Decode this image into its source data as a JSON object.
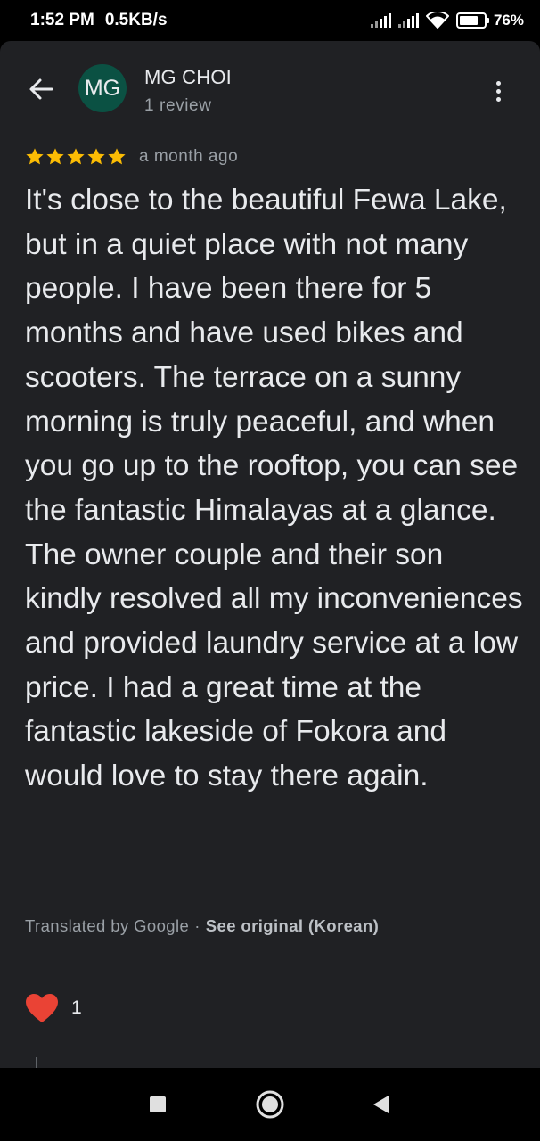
{
  "status_bar": {
    "time": "1:52 PM",
    "speed": "0.5KB/s",
    "battery_percent": "76",
    "battery_level": 0.76
  },
  "header": {
    "back_icon": "arrow-back-icon",
    "avatar_initials": "MG",
    "avatar_color": "#0b5143",
    "author_name": "MG CHOI",
    "author_meta": "1 review",
    "menu_icon": "more-vert-icon"
  },
  "review": {
    "rating": 5,
    "star_color": "#fbbc04",
    "date": "a month ago",
    "text": "It's close to the beautiful Fewa Lake, but in a quiet place with not many people. I have been there for 5 months and have used bikes and scooters. The terrace on a sunny morning is truly peaceful, and when you go up to the rooftop, you can see the fantastic Himalayas at a glance. The owner couple and their son kindly resolved all my inconveniences and provided laundry service at a low price. I had a great time at the fantastic lakeside of Fokora and would love to stay there again.",
    "translated_by": "Translated by Google",
    "separator": "·",
    "see_original": "See original (Korean)"
  },
  "reactions": {
    "icon": "heart-icon",
    "color": "#ea4335",
    "count": "1"
  },
  "nav_bar": {
    "recent_icon": "square-icon",
    "home_icon": "circle-icon",
    "back_icon": "triangle-back-icon"
  }
}
